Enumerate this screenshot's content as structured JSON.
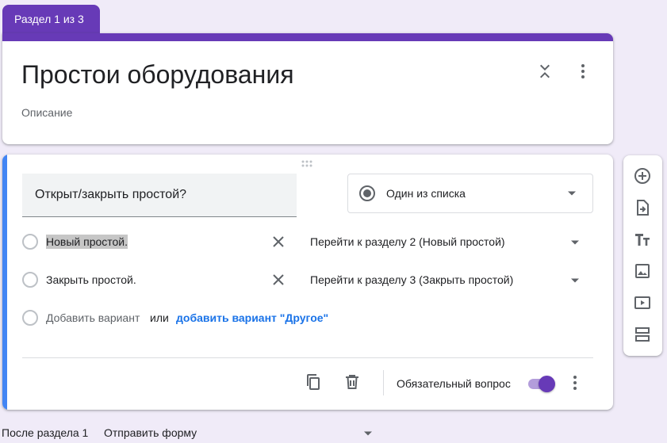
{
  "section_tab": {
    "label": "Раздел 1 из 3"
  },
  "header": {
    "title": "Простои оборудования",
    "description": "Описание"
  },
  "question": {
    "text": "Открыт/закрыть простой?",
    "type": "Один из списка",
    "options": [
      {
        "label": "Новый простой.",
        "goto": "Перейти к разделу 2 (Новый простой)"
      },
      {
        "label": "Закрыть простой.",
        "goto": "Перейти к разделу 3 (Закрыть простой)"
      }
    ],
    "add_option": "Добавить вариант",
    "or": "или",
    "add_other": "добавить вариант \"Другое\"",
    "required_label": "Обязательный вопрос",
    "required": true
  },
  "footer": {
    "after_section": "После раздела 1",
    "after_action": "Отправить форму"
  },
  "colors": {
    "accent": "#673ab7",
    "question_accent": "#4285f4",
    "background": "#f0ebf8",
    "link": "#1a73e8"
  },
  "icons": {
    "collapse": "collapse-icon",
    "more": "more-vert-icon",
    "drag": "drag-handle-icon",
    "radio": "radio-button-icon",
    "remove": "close-icon",
    "dropdown": "arrow-drop-down-icon",
    "copy": "copy-icon",
    "delete": "trash-icon",
    "toolbar": [
      "add-circle-icon",
      "import-icon",
      "title-icon",
      "image-icon",
      "video-icon",
      "section-icon"
    ]
  }
}
